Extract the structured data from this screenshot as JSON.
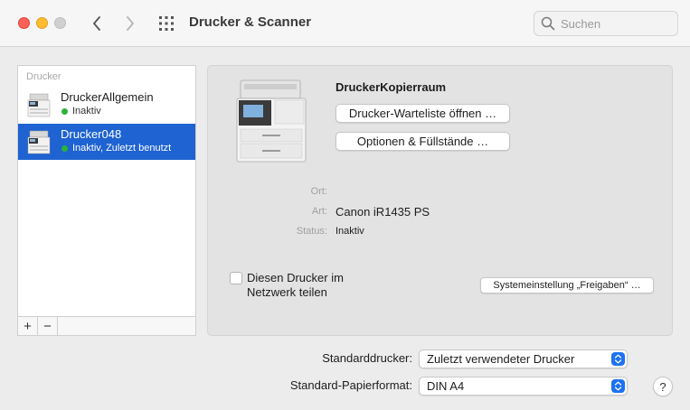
{
  "window": {
    "title": "Drucker & Scanner",
    "search_placeholder": "Suchen"
  },
  "sidebar": {
    "header": "Drucker",
    "printers": [
      {
        "name": "DruckerAllgemein",
        "status": "Inaktiv",
        "selected": false,
        "status_color": "#29b33a"
      },
      {
        "name": "Drucker048",
        "status": "Inaktiv, Zuletzt benutzt",
        "selected": true,
        "status_color": "#29b33a"
      }
    ],
    "add_label": "+",
    "remove_label": "−"
  },
  "detail": {
    "printer_name": "DruckerKopierraum",
    "queue_button": "Drucker-Warteliste öffnen …",
    "options_button": "Optionen & Füllstände …",
    "location_label": "Ort:",
    "location_value": "",
    "kind_label": "Art:",
    "kind_value": "Canon iR1435 PS",
    "status_label": "Status:",
    "status_value": "Inaktiv",
    "share_checkbox_label": "Diesen Drucker im Netzwerk teilen",
    "share_checked": false,
    "sharing_prefs_button": "Systemeinstellung „Freigaben“ …"
  },
  "defaults": {
    "default_printer_label": "Standarddrucker:",
    "default_printer_value": "Zuletzt verwendeter Drucker",
    "paper_size_label": "Standard-Papierformat:",
    "paper_size_value": "DIN A4"
  },
  "help_label": "?",
  "colors": {
    "selection": "#1e63d1",
    "accent": "#1e72f0",
    "status_green": "#29b33a"
  }
}
